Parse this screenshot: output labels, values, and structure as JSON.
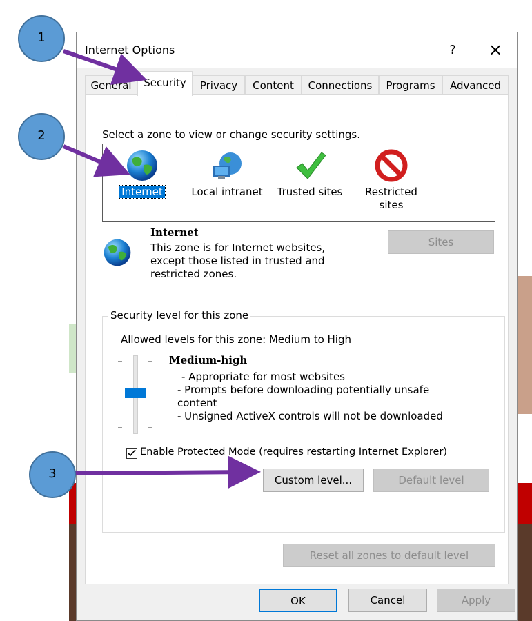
{
  "dialog": {
    "title": "Internet Options",
    "help_label": "?",
    "close_label": "×"
  },
  "tabs": [
    {
      "label": "General",
      "active": false
    },
    {
      "label": "Security",
      "active": true
    },
    {
      "label": "Privacy",
      "active": false
    },
    {
      "label": "Content",
      "active": false
    },
    {
      "label": "Connections",
      "active": false
    },
    {
      "label": "Programs",
      "active": false
    },
    {
      "label": "Advanced",
      "active": false
    }
  ],
  "zones": {
    "instruction": "Select a zone to view or change security settings.",
    "items": [
      {
        "label": "Internet",
        "icon": "globe-icon",
        "selected": true
      },
      {
        "label": "Local intranet",
        "icon": "network-globe-icon",
        "selected": false
      },
      {
        "label": "Trusted sites",
        "icon": "checkmark-icon",
        "selected": false
      },
      {
        "label": "Restricted sites",
        "icon": "prohibited-icon",
        "selected": false
      }
    ]
  },
  "zone_info": {
    "title": "Internet",
    "description_line1": "This zone is for Internet websites,",
    "description_line2": "except those listed in trusted and",
    "description_line3": "restricted zones.",
    "sites_label": "Sites"
  },
  "security_level": {
    "group_title": "Security level for this zone",
    "allowed": "Allowed levels for this zone: Medium to High",
    "level_name": "Medium-high",
    "bullet1": "- Appropriate for most websites",
    "bullet2": "- Prompts before downloading potentially unsafe",
    "bullet2b": "content",
    "bullet3": "- Unsigned ActiveX controls will not be downloaded",
    "slider_level": "Medium-high",
    "protected_mode_label": "Enable Protected Mode (requires restarting Internet Explorer)",
    "protected_mode_checked": true,
    "custom_level_label": "Custom level...",
    "default_level_label": "Default level",
    "reset_all_label": "Reset all zones to default level"
  },
  "footer": {
    "ok_label": "OK",
    "cancel_label": "Cancel",
    "apply_label": "Apply"
  },
  "annotations": {
    "callout1": "1",
    "callout2": "2",
    "callout3": "3",
    "arrow_color": "#7030a0",
    "callout_color": "#5b9bd5"
  },
  "colors": {
    "selection": "#0078d7",
    "disabled_button": "#cccccc",
    "dialog_bg": "#f0f0f0"
  }
}
